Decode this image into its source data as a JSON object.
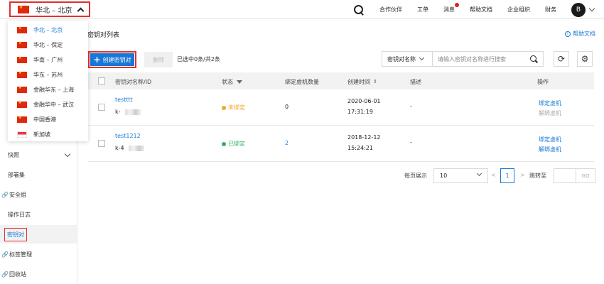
{
  "topbar": {
    "region_label": "华北 – 北京",
    "links": {
      "partners": "合作伙伴",
      "tickets": "工单",
      "messages": "消息",
      "help_docs": "帮助文档",
      "org": "企业组织",
      "finance": "财务"
    },
    "avatar_initial": "B"
  },
  "region_dropdown": {
    "items": [
      {
        "label": "华北 – 北京",
        "flag": "cn",
        "selected": true
      },
      {
        "label": "华北 – 保定",
        "flag": "cn"
      },
      {
        "label": "华南 – 广州",
        "flag": "cn"
      },
      {
        "label": "华东 – 苏州",
        "flag": "cn"
      },
      {
        "label": "金融华东 – 上海",
        "flag": "cn"
      },
      {
        "label": "金融华中 – 武汉",
        "flag": "cn"
      },
      {
        "label": "中国香港",
        "flag": "cn"
      },
      {
        "label": "新加坡",
        "flag": "sg"
      }
    ]
  },
  "sidebar": {
    "items": [
      {
        "label": "快照",
        "has_chevron": true
      },
      {
        "label": "部署集"
      },
      {
        "label": "安全组",
        "link_icon": true
      },
      {
        "label": "操作日志"
      },
      {
        "label": "密钥对",
        "active": true
      },
      {
        "label": "标签管理",
        "link_icon": true
      },
      {
        "label": "回收站",
        "link_icon": true
      }
    ]
  },
  "main": {
    "title": "密钥对列表",
    "help_link": "帮助文档",
    "create_button": "创建密钥对",
    "delete_button": "删除",
    "selection_info": "已选中0条/共2条",
    "search": {
      "field_select": "密钥对名称",
      "placeholder": "请输入密钥对名称进行搜索"
    }
  },
  "table": {
    "columns": {
      "name": "密钥对名称/ID",
      "status": "状态",
      "bound_count": "绑定虚机数量",
      "created": "创建时间",
      "desc": "描述",
      "actions": "操作"
    },
    "rows": [
      {
        "name": "testttt",
        "id_prefix": "k-",
        "status": "未绑定",
        "status_color": "#f5a623",
        "bound_count": "0",
        "created_date": "2020-06-01",
        "created_time": "17:31:19",
        "desc": "-",
        "action_bind": "绑定虚机",
        "action_unbind": "解绑虚机"
      },
      {
        "name": "test1212",
        "id_prefix": "k-4",
        "status": "已绑定",
        "status_color": "#2db55d",
        "bound_count": "2",
        "created_date": "2018-12-12",
        "created_time": "15:24:21",
        "desc": "-",
        "action_bind": "绑定虚机",
        "action_unbind": "解绑虚机"
      }
    ]
  },
  "pagination": {
    "per_page_label": "每页展示",
    "per_page_value": "10",
    "prev": "<",
    "current_page": "1",
    "next": ">",
    "jump_label": "跳转至",
    "go": "GO"
  },
  "colors": {
    "accent": "#1778d6",
    "highlight_border": "#e03030"
  }
}
